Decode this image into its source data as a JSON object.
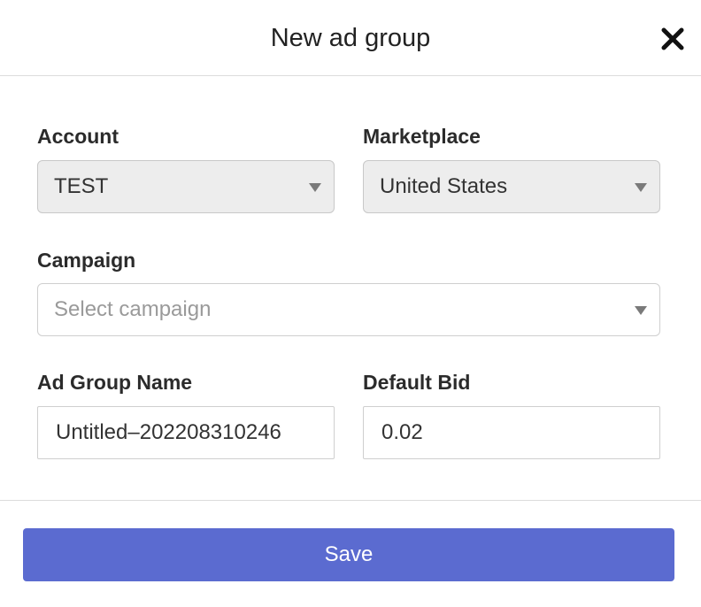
{
  "dialog": {
    "title": "New ad group"
  },
  "form": {
    "account": {
      "label": "Account",
      "value": "TEST"
    },
    "marketplace": {
      "label": "Marketplace",
      "value": "United States"
    },
    "campaign": {
      "label": "Campaign",
      "placeholder": "Select campaign"
    },
    "ad_group_name": {
      "label": "Ad Group Name",
      "value": "Untitled–202208310246"
    },
    "default_bid": {
      "label": "Default Bid",
      "value": "0.02"
    }
  },
  "footer": {
    "save_label": "Save"
  },
  "colors": {
    "primary": "#5b6bd0",
    "disabled_bg": "#ededed"
  },
  "icons": {
    "close": "close-icon",
    "dropdown": "chevron-down-icon"
  }
}
